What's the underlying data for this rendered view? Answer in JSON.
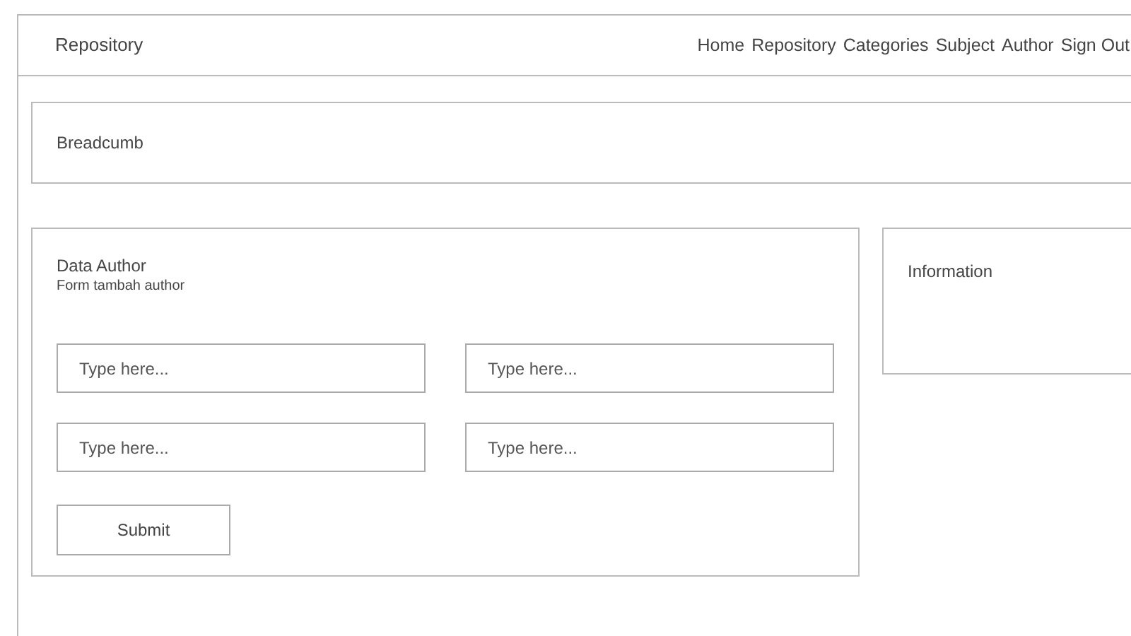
{
  "header": {
    "brand": "Repository",
    "nav": [
      "Home",
      "Repository",
      "Categories",
      "Subject",
      "Author",
      "Sign Out"
    ]
  },
  "breadcrumb": "Breadcumb",
  "form": {
    "title": "Data Author",
    "subtitle": "Form tambah author",
    "fields": [
      {
        "placeholder": "Type here..."
      },
      {
        "placeholder": "Type here..."
      },
      {
        "placeholder": "Type here..."
      },
      {
        "placeholder": "Type here..."
      }
    ],
    "submit": "Submit"
  },
  "info": {
    "title": "Information"
  }
}
